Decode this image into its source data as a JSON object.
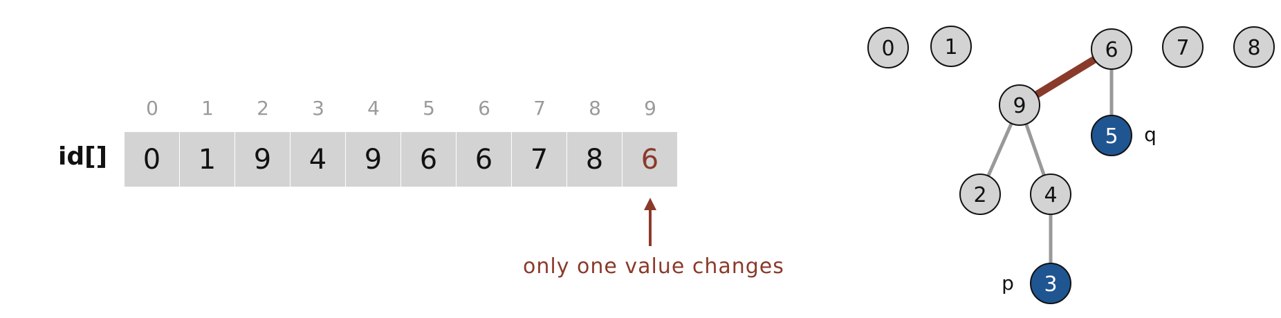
{
  "array": {
    "label": "id[]",
    "indices": [
      "0",
      "1",
      "2",
      "3",
      "4",
      "5",
      "6",
      "7",
      "8",
      "9"
    ],
    "values": [
      "0",
      "1",
      "9",
      "4",
      "9",
      "6",
      "6",
      "7",
      "8",
      "6"
    ],
    "changed_index": 9,
    "note": "only one value changes"
  },
  "tree": {
    "nodes": [
      "0",
      "1",
      "6",
      "7",
      "8",
      "9",
      "5",
      "2",
      "4",
      "3"
    ],
    "edges": [
      [
        "9",
        "6"
      ],
      [
        "5",
        "6"
      ],
      [
        "2",
        "9"
      ],
      [
        "4",
        "9"
      ],
      [
        "3",
        "4"
      ]
    ],
    "highlighted_edge": [
      "9",
      "6"
    ],
    "highlighted_nodes": [
      "5",
      "3"
    ],
    "p_label": "p",
    "q_label": "q"
  },
  "colors": {
    "cell_bg": "#d3d3d3",
    "index_text": "#9a9a9a",
    "accent": "#8a3a2a",
    "highlight_node": "#1f5591",
    "node_fill": "#d3d3d3"
  }
}
